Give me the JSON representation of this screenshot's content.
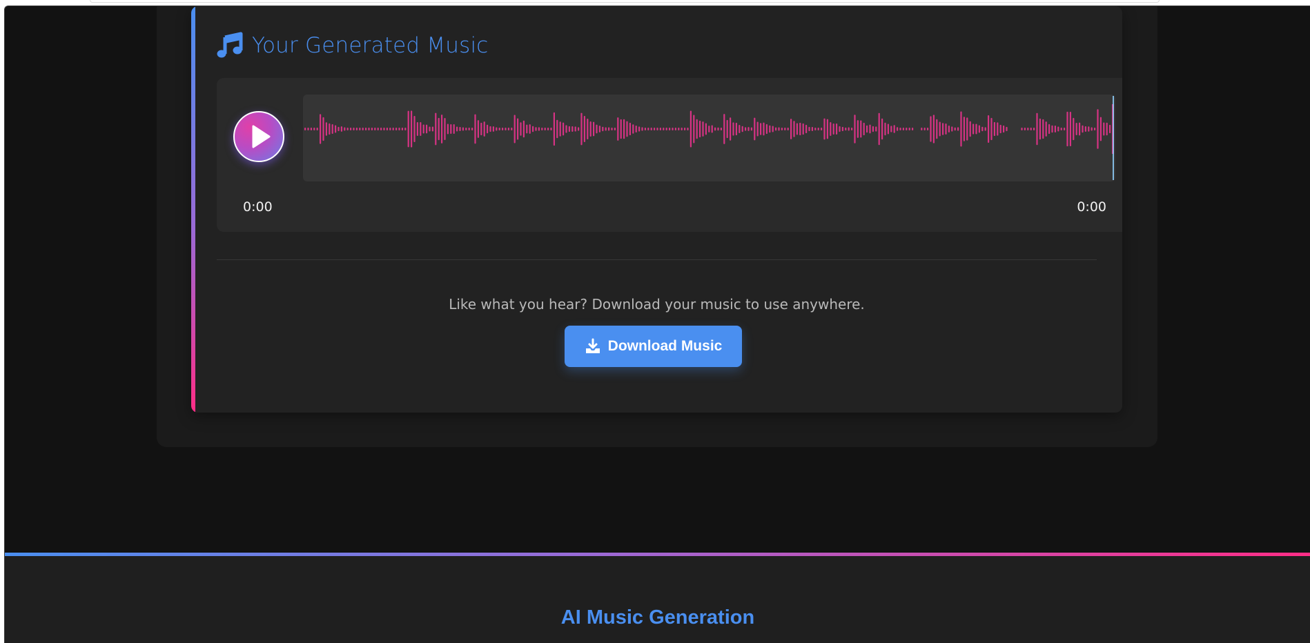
{
  "result": {
    "title": "Your Generated Music",
    "title_icon": "music-note-icon",
    "player": {
      "play_icon": "play-icon",
      "current_time": "0:00",
      "total_time": "0:00",
      "progress": 0,
      "wave_color": "#d63384"
    },
    "download_message": "Like what you hear? Download your music to use anywhere.",
    "download_button": {
      "label": "Download Music",
      "icon": "download-icon"
    }
  },
  "footer": {
    "title": "AI Music Generation"
  },
  "colors": {
    "accent": "#4a8ff0",
    "pink": "#ff2d86",
    "background": "#121212",
    "card": "#222222"
  }
}
